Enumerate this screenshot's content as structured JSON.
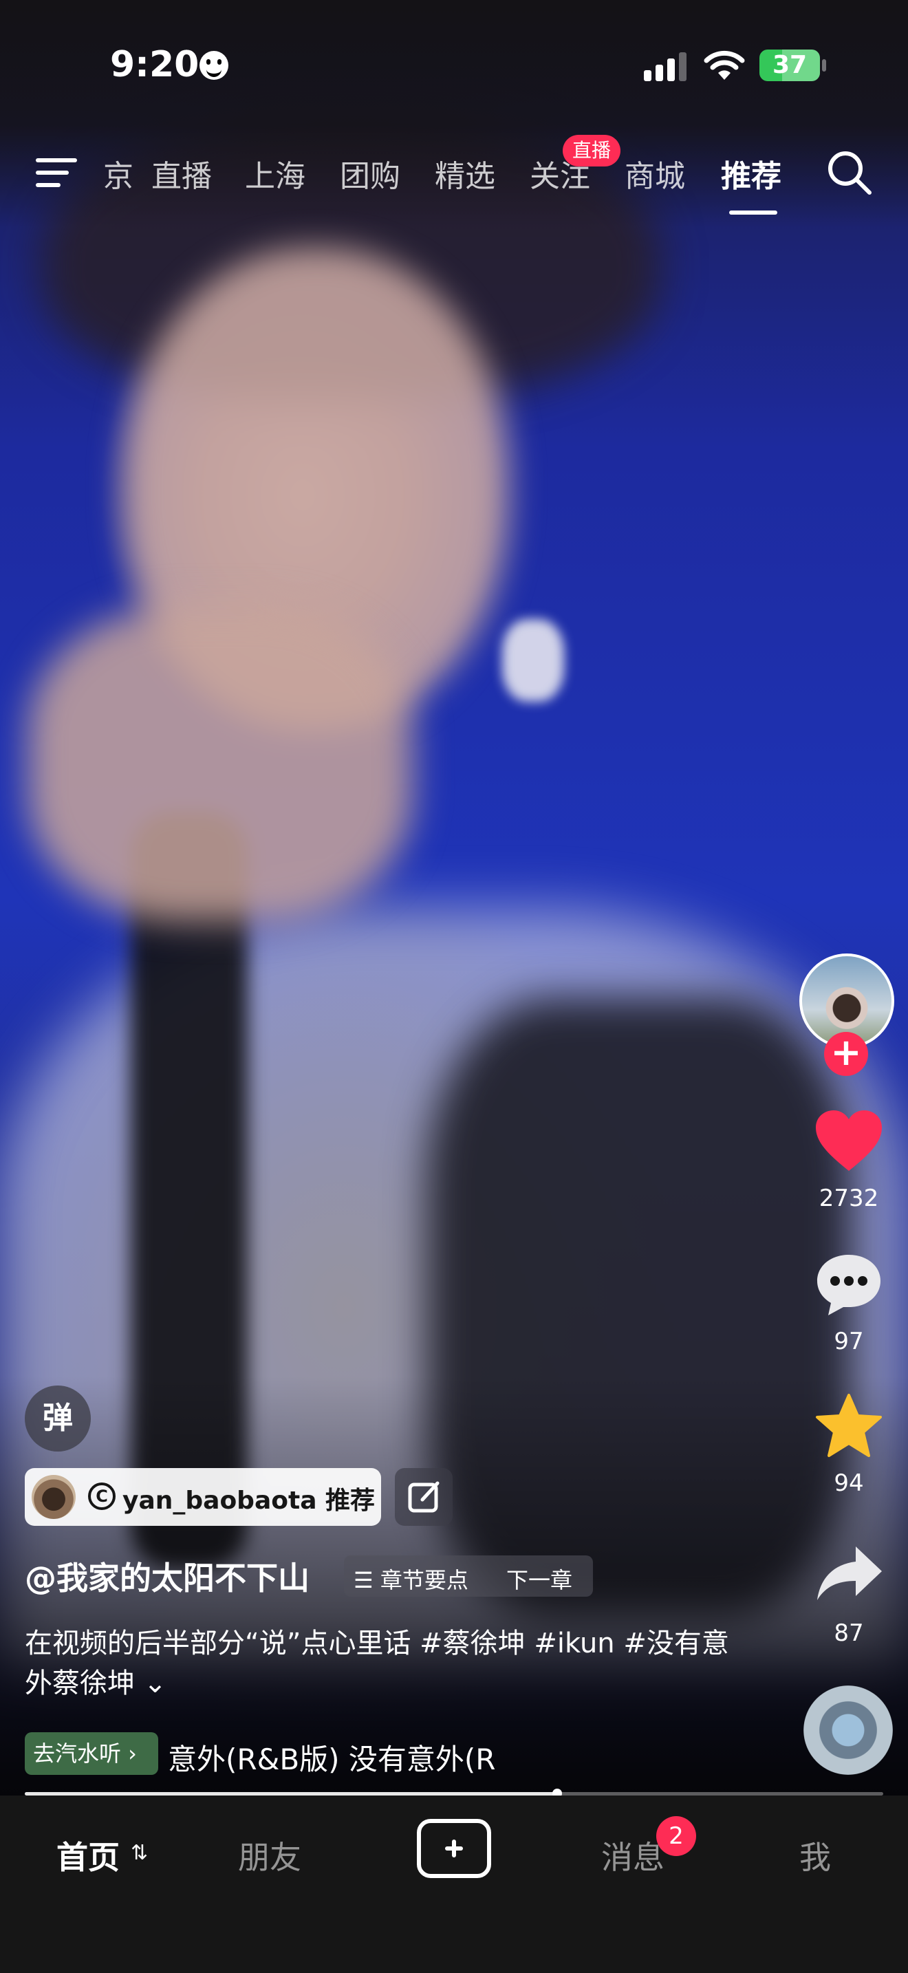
{
  "status_bar": {
    "time": "9:20",
    "battery": "37"
  },
  "top_nav": {
    "tabs": [
      "京",
      "直播",
      "上海",
      "团购",
      "精选",
      "关注",
      "商城",
      "推荐"
    ],
    "active_tab": "推荐",
    "live_badge": "直播"
  },
  "right_rail": {
    "likes": "2732",
    "comments": "97",
    "favorites": "94",
    "shares": "87"
  },
  "danmaku_label": "弹",
  "recommend_tag": {
    "copy_symbol": "C",
    "text": "yan_baobaota 推荐"
  },
  "caption": {
    "author": "@我家的太阳不下山",
    "chapter_points": "☰ 章节要点",
    "next_chapter": "下一章",
    "description": "在视频的后半部分“说”点心里话 #蔡徐坤 #ikun #没有意外蔡徐坤 ⌄"
  },
  "music": {
    "chip_label": "去汽水听 ›",
    "track_title": "意外(R&B版)    没有意外(R"
  },
  "progress": {
    "played": 0.62
  },
  "bottom_nav": {
    "home": "首页",
    "home_switch": "⇅",
    "friends": "朋友",
    "messages": "消息",
    "messages_badge": "2",
    "me": "我"
  },
  "colors": {
    "accent": "#fe2c55",
    "music_chip": "#3e6b46",
    "battery": "#34c759",
    "favorite": "#fbc02d"
  }
}
